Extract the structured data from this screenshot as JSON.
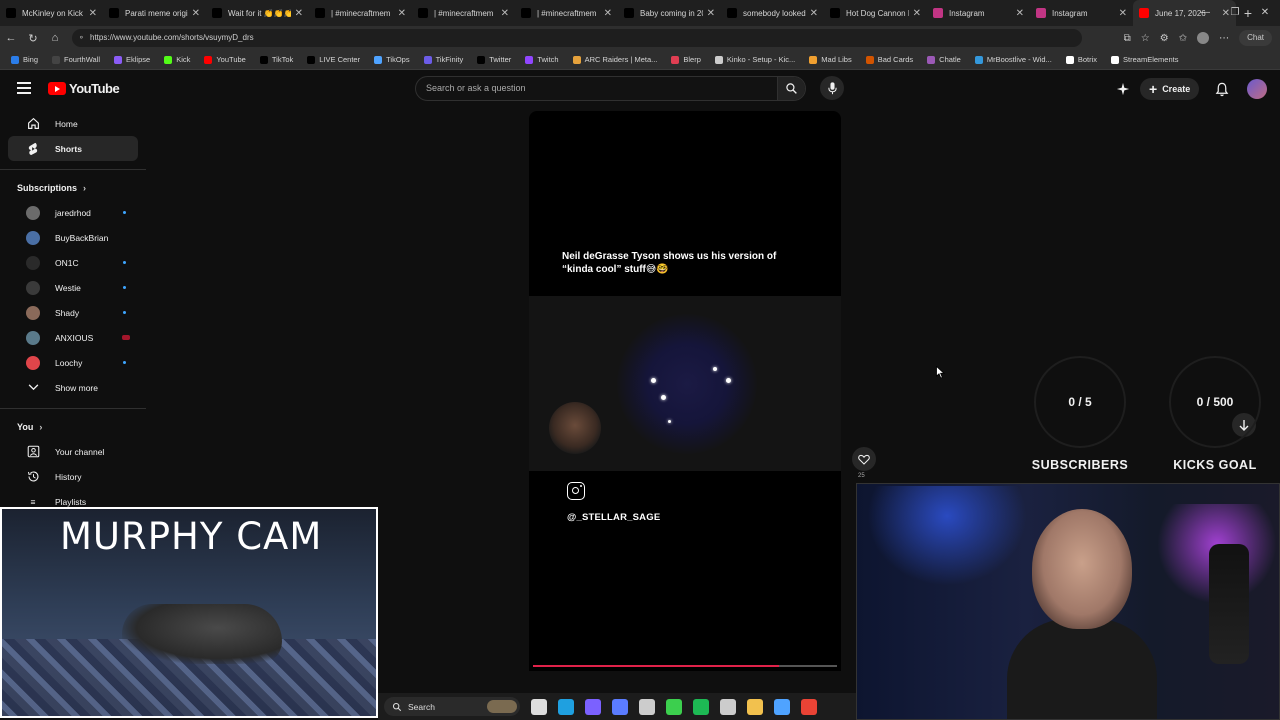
{
  "browser": {
    "tabs": [
      {
        "title": "McKinley on Kick (M",
        "color": "#000000",
        "icon": "tiktok-icon"
      },
      {
        "title": "Parati meme original",
        "color": "#000000",
        "icon": "tiktok-icon"
      },
      {
        "title": "Wait for it 👏👏👏",
        "color": "#000000",
        "icon": "tiktok-icon"
      },
      {
        "title": "| #minecraftmem",
        "color": "#000000",
        "icon": "tiktok-icon"
      },
      {
        "title": "| #minecraftmem",
        "color": "#000000",
        "icon": "tiktok-icon"
      },
      {
        "title": "| #minecraftmem",
        "color": "#000000",
        "icon": "tiktok-icon"
      },
      {
        "title": "Baby coming in 203",
        "color": "#000000",
        "icon": "tiktok-icon"
      },
      {
        "title": "somebody looked a",
        "color": "#000000",
        "icon": "tiktok-icon"
      },
      {
        "title": "Hot Dog Cannon N",
        "color": "#000000",
        "icon": "tiktok-icon"
      },
      {
        "title": "Instagram",
        "color": "#c13584",
        "icon": "instagram-icon"
      },
      {
        "title": "Instagram",
        "color": "#c13584",
        "icon": "instagram-icon"
      },
      {
        "title": "June 17, 2026",
        "color": "#ff0000",
        "icon": "youtube-icon",
        "active": true
      }
    ],
    "url": "https://www.youtube.com/shorts/vsuymyD_drs",
    "chat_label": "Chat",
    "bookmarks": [
      {
        "label": "Bing",
        "color": "#2b7de9"
      },
      {
        "label": "FourthWall",
        "color": "#444444"
      },
      {
        "label": "Eklipse",
        "color": "#8b5cf6"
      },
      {
        "label": "Kick",
        "color": "#53fc18"
      },
      {
        "label": "YouTube",
        "color": "#ff0000"
      },
      {
        "label": "TikTok",
        "color": "#000000"
      },
      {
        "label": "LIVE Center",
        "color": "#000000"
      },
      {
        "label": "TikOps",
        "color": "#4fa3ff"
      },
      {
        "label": "TikFinity",
        "color": "#6c5ce7"
      },
      {
        "label": "Twitter",
        "color": "#000000"
      },
      {
        "label": "Twitch",
        "color": "#9146ff"
      },
      {
        "label": "ARC Raiders | Meta...",
        "color": "#e6a23c"
      },
      {
        "label": "Blerp",
        "color": "#e03e52"
      },
      {
        "label": "Kinko - Setup - Kic...",
        "color": "#cccccc"
      },
      {
        "label": "Mad Libs",
        "color": "#f0a030"
      },
      {
        "label": "Bad Cards",
        "color": "#d35400"
      },
      {
        "label": "Chatle",
        "color": "#9b59b6"
      },
      {
        "label": "MrBoostlive - Wid...",
        "color": "#3498db"
      },
      {
        "label": "Botrix",
        "color": "#ffffff"
      },
      {
        "label": "StreamElements",
        "color": "#ffffff"
      }
    ]
  },
  "youtube": {
    "logo_text": "YouTube",
    "search_placeholder": "Search or ask a question",
    "create_label": "Create",
    "sidebar": {
      "home": "Home",
      "shorts": "Shorts",
      "subscriptions_title": "Subscriptions",
      "subscriptions": [
        {
          "name": "jaredrhod",
          "color": "#6b6b6b",
          "live": "dot"
        },
        {
          "name": "BuyBackBrian",
          "color": "#4a6fa5",
          "live": ""
        },
        {
          "name": "ON1C",
          "color": "#2a2a2a",
          "live": "dot"
        },
        {
          "name": "Westie",
          "color": "#3a3a3a",
          "live": "dot"
        },
        {
          "name": "Shady",
          "color": "#8a6a5a",
          "live": "dot"
        },
        {
          "name": "ANXIOUS",
          "color": "#5a7a8a",
          "live": "red"
        },
        {
          "name": "Loochy",
          "color": "#e0454a",
          "live": "dot"
        }
      ],
      "show_more": "Show more",
      "you_title": "You",
      "your_channel": "Your channel",
      "history": "History",
      "playlists": "Playlists"
    },
    "short": {
      "caption_line1": "Neil deGrasse Tyson shows us his version of",
      "caption_line2": "“kinda cool” stuff😅🤓",
      "handle": "@_STELLAR_SAGE",
      "progress": 0.81
    },
    "like_count": "25"
  },
  "overlays": {
    "subscribers": {
      "value": "0 / 5",
      "label": "SUBSCRIBERS"
    },
    "kicks": {
      "value": "0 / 500",
      "label": "KICKS GOAL"
    },
    "murphy_title": "MURPHY CAM"
  },
  "taskbar": {
    "search_label": "Search",
    "apps": [
      {
        "icon": "task-view-icon",
        "color": "#dddddd"
      },
      {
        "icon": "edge-icon",
        "color": "#1fa0e0"
      },
      {
        "icon": "copilot-icon",
        "color": "#7b61ff"
      },
      {
        "icon": "grid-app-icon",
        "color": "#5b7cff"
      },
      {
        "icon": "xbox-icon",
        "color": "#cccccc"
      },
      {
        "icon": "green-app-icon",
        "color": "#3ccf4e"
      },
      {
        "icon": "spotify-icon",
        "color": "#1db954"
      },
      {
        "icon": "cube-app-icon",
        "color": "#cccccc"
      },
      {
        "icon": "folder-icon",
        "color": "#f2c14e"
      },
      {
        "icon": "notes-app-icon",
        "color": "#4fa3ff"
      },
      {
        "icon": "chrome-icon",
        "color": "#ea4335"
      }
    ]
  }
}
